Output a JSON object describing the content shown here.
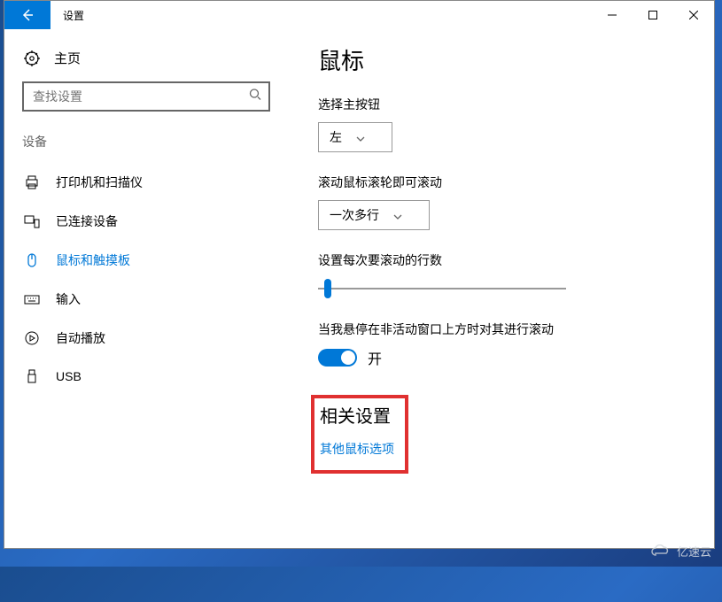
{
  "window": {
    "title": "设置"
  },
  "sidebar": {
    "home_label": "主页",
    "search_placeholder": "查找设置",
    "section_label": "设备",
    "items": [
      {
        "label": "打印机和扫描仪"
      },
      {
        "label": "已连接设备"
      },
      {
        "label": "鼠标和触摸板"
      },
      {
        "label": "输入"
      },
      {
        "label": "自动播放"
      },
      {
        "label": "USB"
      }
    ]
  },
  "content": {
    "page_title": "鼠标",
    "primary_button_label": "选择主按钮",
    "primary_button_value": "左",
    "scroll_mode_label": "滚动鼠标滚轮即可滚动",
    "scroll_mode_value": "一次多行",
    "lines_label": "设置每次要滚动的行数",
    "slider_percent": 4,
    "inactive_label": "当我悬停在非活动窗口上方时对其进行滚动",
    "toggle_on_label": "开",
    "related_title": "相关设置",
    "other_mouse_link": "其他鼠标选项"
  },
  "watermark": "亿速云"
}
